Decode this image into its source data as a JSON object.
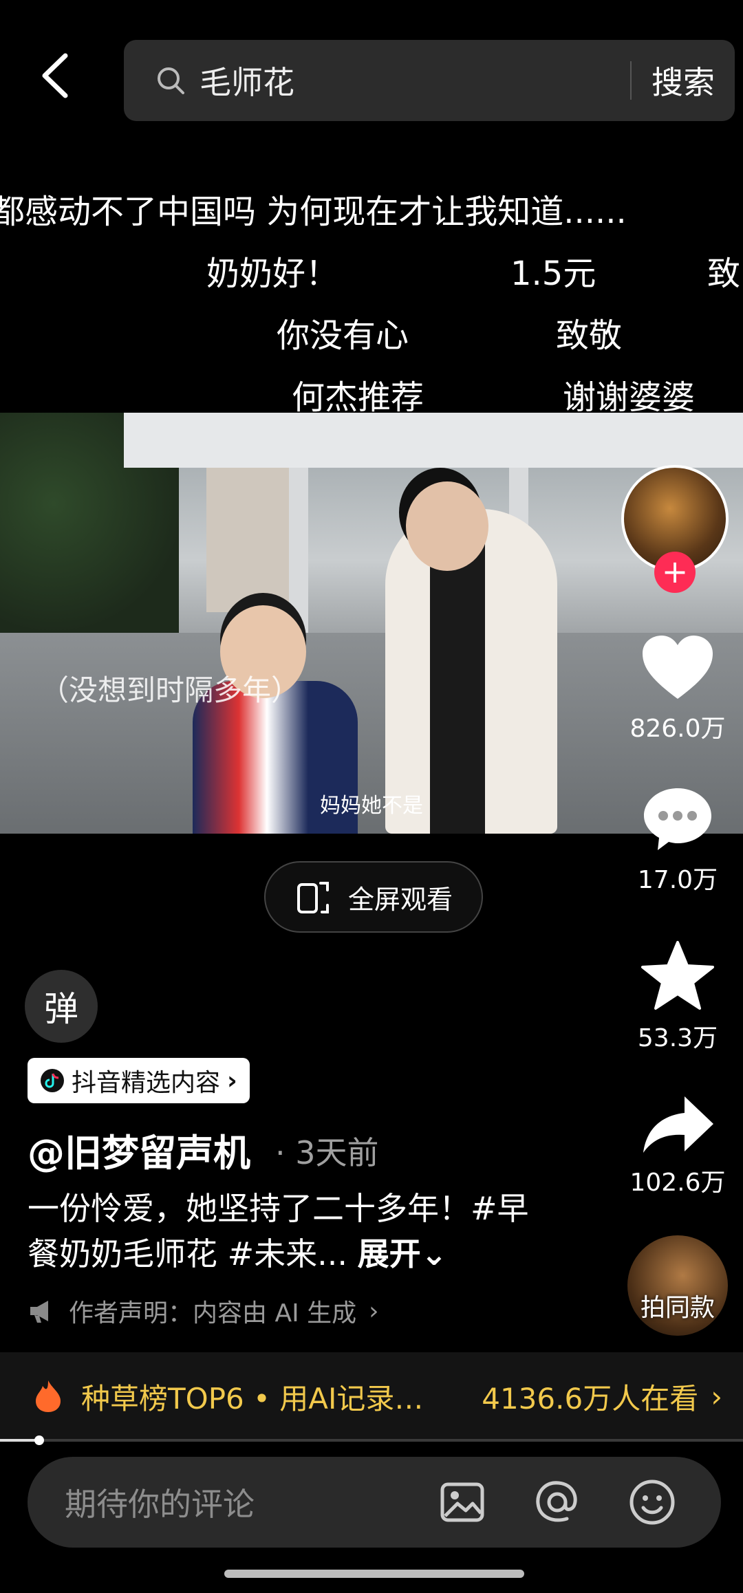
{
  "search": {
    "query": "毛师花",
    "button_label": "搜索"
  },
  "danmaku": {
    "line1": "都感动不了中国吗 为何现在才让我知道......",
    "line2": [
      "奶奶好！",
      "1.5元",
      "致"
    ],
    "line3": [
      "你没有心",
      "致敬"
    ],
    "line4": [
      "何杰推荐",
      "谢谢婆婆"
    ]
  },
  "video": {
    "caption_left": "（没想到时隔多年）",
    "caption_bottom": "妈妈她不是"
  },
  "rail": {
    "like_count": "826.0万",
    "comment_count": "17.0万",
    "favorite_count": "53.3万",
    "share_count": "102.6万",
    "same_style_label": "拍同款"
  },
  "fullscreen_label": "全屏观看",
  "danmaku_toggle_label": "弹",
  "badge_label": "抖音精选内容",
  "post": {
    "author": "@旧梦留声机",
    "time": "· 3天前",
    "description": "一份怜爱，她坚持了二十多年！#早餐奶奶毛师花 #未来...",
    "expand_label": "展开",
    "declaration": "作者声明：内容由 AI 生成"
  },
  "trend": {
    "label": "种草榜TOP6 • 用AI记录…",
    "viewers": "4136.6万人在看"
  },
  "comment": {
    "placeholder": "期待你的评论"
  },
  "colors": {
    "accent_red": "#fe2c55",
    "trend_gold": "#f2c94c",
    "background": "#000000"
  },
  "icons": [
    "back-arrow-icon",
    "search-icon",
    "heart-icon",
    "comment-icon",
    "star-icon",
    "share-icon",
    "fullscreen-icon",
    "douyin-logo-icon",
    "megaphone-icon",
    "fire-icon",
    "image-icon",
    "at-icon",
    "emoji-icon"
  ]
}
